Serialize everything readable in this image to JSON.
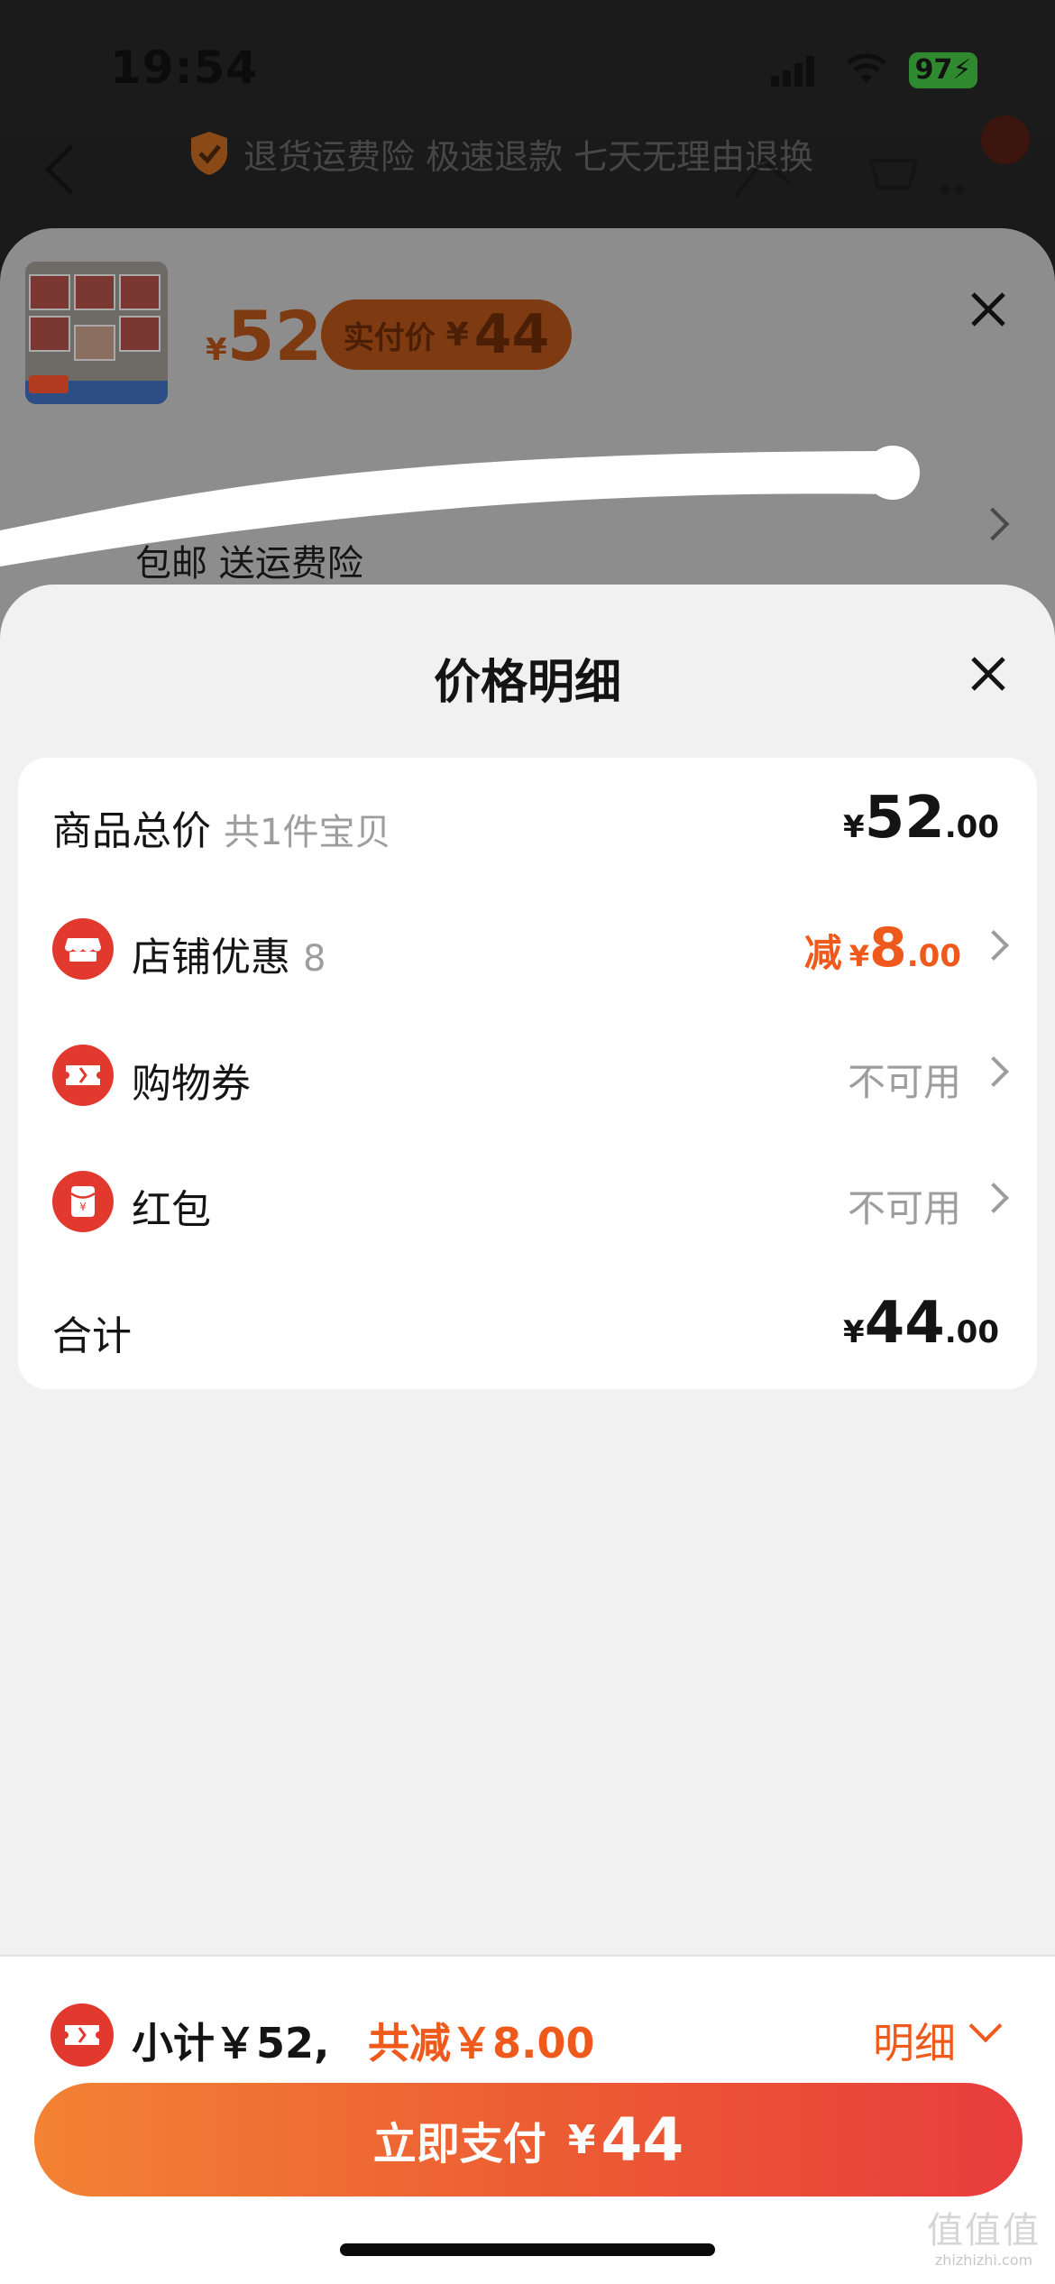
{
  "status_bar": {
    "time": "19:54",
    "battery": "97"
  },
  "header": {
    "guarantee_text": "退货运费险 极速退款 七天无理由退换"
  },
  "product_sheet": {
    "price_yen": "¥",
    "price": "52",
    "actual_pay_label": "实付价",
    "actual_pay_yen": "¥",
    "actual_pay_value": "44",
    "shipping_text": "包邮  送运费险"
  },
  "price_detail": {
    "title": "价格明细",
    "rows": [
      {
        "label": "商品总价",
        "sub": "共1件宝贝",
        "yen": "¥",
        "int": "52",
        "dec": ".00"
      },
      {
        "label": "店铺优惠",
        "sub": "8",
        "minus": "减",
        "yen": "¥",
        "int": "8",
        "dec": ".00",
        "icon": "store-icon"
      },
      {
        "label": "购物券",
        "status": "不可用",
        "icon": "ticket-icon"
      },
      {
        "label": "红包",
        "status": "不可用",
        "icon": "red-envelope-icon"
      },
      {
        "label": "合计",
        "yen": "¥",
        "int": "44",
        "dec": ".00"
      }
    ]
  },
  "bottom_bar": {
    "subtotal": "小计￥52,",
    "saved": "共减￥8.00",
    "detail": "明细",
    "pay_label": "立即支付",
    "pay_yen": "¥",
    "pay_amount": "44"
  },
  "watermark": {
    "logo": "值值值",
    "domain": "zhizhizhi.com"
  },
  "colors": {
    "accent": "#ef5a1c",
    "icon_red": "#e2392f",
    "pay_gradient_start": "#f38234",
    "pay_gradient_end": "#e83d3d"
  }
}
